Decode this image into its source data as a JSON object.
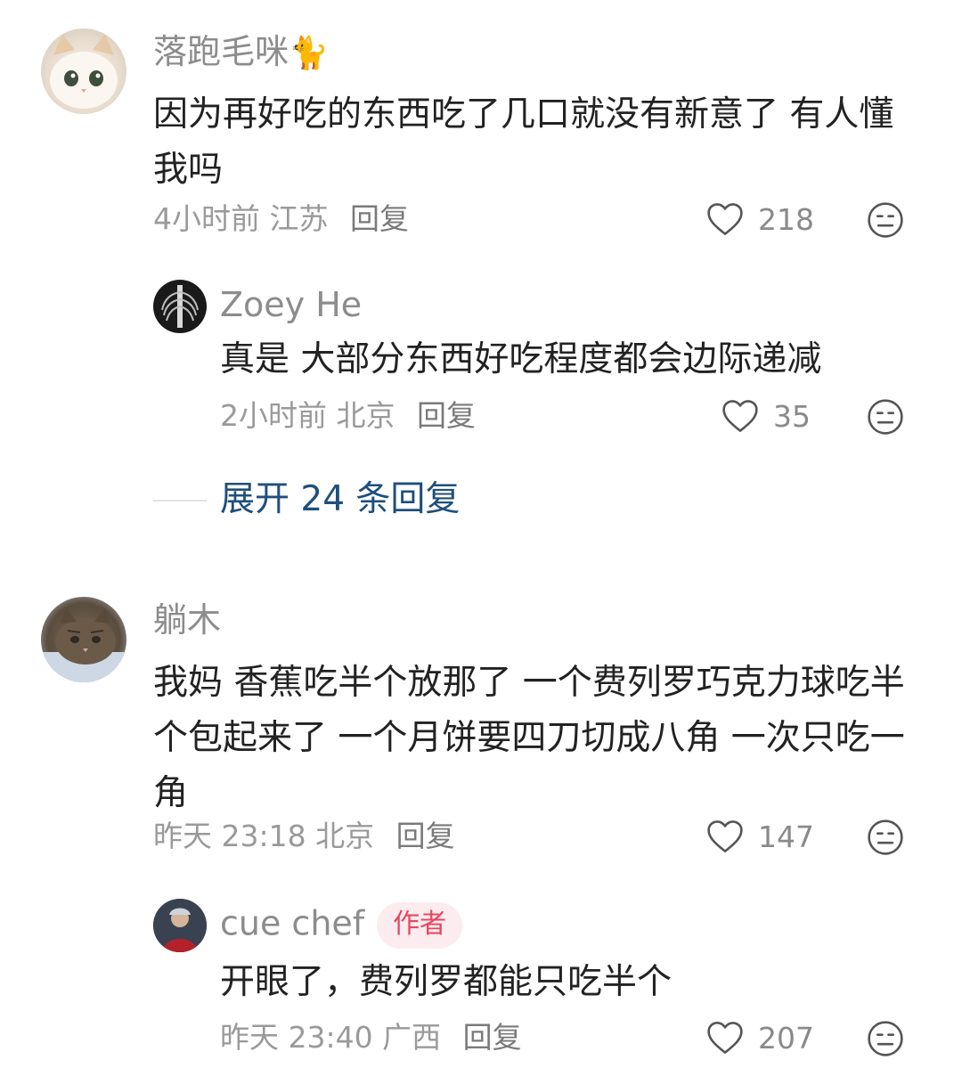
{
  "comments": [
    {
      "username": "落跑毛咪",
      "username_emoji": "🐈",
      "text": "因为再好吃的东西吃了几口就没有新意了 有人懂我吗",
      "time": "4小时前",
      "location": "江苏",
      "reply_label": "回复",
      "likes": "218",
      "replies": [
        {
          "username": "Zoey He",
          "text": "真是 大部分东西好吃程度都会边际递减",
          "time": "2小时前",
          "location": "北京",
          "reply_label": "回复",
          "likes": "35"
        }
      ],
      "expand_label": "展开 24 条回复"
    },
    {
      "username": "躺木",
      "text": "我妈  香蕉吃半个放那了  一个费列罗巧克力球吃半个包起来了 一个月饼要四刀切成八角 一次只吃一角",
      "time": "昨天 23:18",
      "location": "北京",
      "reply_label": "回复",
      "likes": "147",
      "replies": [
        {
          "username": "cue chef",
          "badge": "作者",
          "text": "开眼了，费列罗都能只吃半个",
          "time": "昨天 23:40",
          "location": "广西",
          "reply_label": "回复",
          "likes": "207"
        }
      ]
    }
  ],
  "icons": {
    "like": "heart-outline-icon",
    "dislike": "meh-face-icon"
  },
  "colors": {
    "link_blue": "#1f4f7c",
    "author_badge_bg": "#fdecef",
    "author_badge_text": "#e8455f",
    "meta_gray": "#9a9a9a"
  }
}
